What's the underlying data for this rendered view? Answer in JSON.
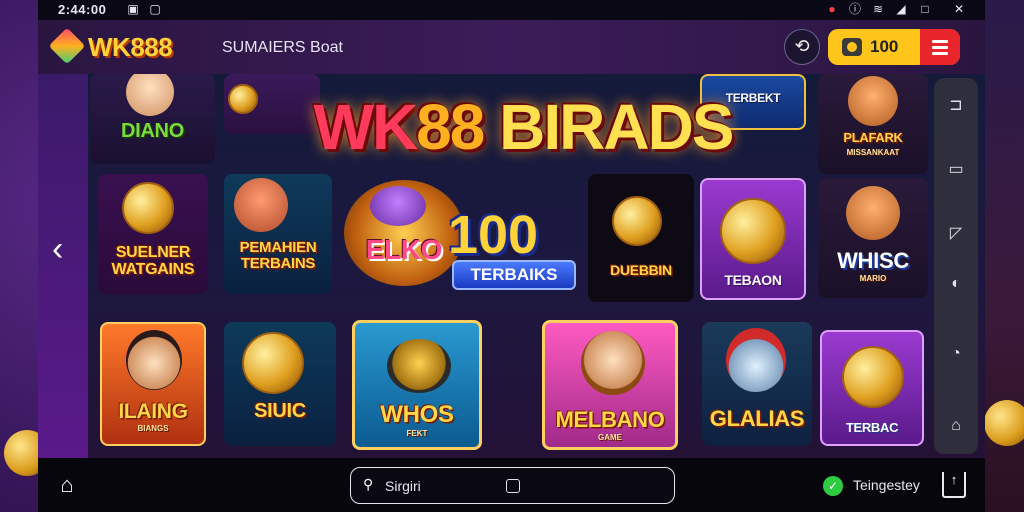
{
  "status_bar": {
    "time": "2:44:00",
    "icons": [
      "app-notification-icon",
      "app-alert-icon",
      "gallery-icon",
      "record-icon",
      "info-icon",
      "wifi-icon",
      "signal-icon",
      "window-icon",
      "close-icon"
    ]
  },
  "app_bar": {
    "logo_text": "WK888",
    "subtitle": "SUMAIERS Boat",
    "balance": "100",
    "colors": {
      "brand_yellow": "#ffc51a",
      "menu_red": "#e8262c"
    }
  },
  "hero": {
    "title_part1": "WK",
    "title_part2": "88",
    "title_part3": " BIRADS",
    "promo_value": "100",
    "promo_label": "TERBAIKS"
  },
  "tiles": [
    {
      "label": "DIANO"
    },
    {
      "label": "TERBEKT"
    },
    {
      "label": "PLAFARK",
      "sub": "MISSANKAAT"
    },
    {
      "label": "SUELNER WATGAINS"
    },
    {
      "label": "PEMAHIEN TERBAINS"
    },
    {
      "label": "ELKO"
    },
    {
      "label": "DUEBBIN"
    },
    {
      "label": "TEBAON"
    },
    {
      "label": "WHISC",
      "sub": "MARIO"
    },
    {
      "label": "ILAING",
      "sub": "BIANGS"
    },
    {
      "label": "SIUIC"
    },
    {
      "label": "WHOS",
      "sub": "FEKT"
    },
    {
      "label": "MELBANO",
      "sub": "GAME"
    },
    {
      "label": "GLALIAS"
    },
    {
      "label": "TERBAC"
    }
  ],
  "right_rail_icons": [
    "bookmark-icon",
    "copy-icon",
    "folder-icon",
    "slider-icon",
    "chat-icon",
    "cloud-icon"
  ],
  "bottom_bar": {
    "search_text": "Sirgiri",
    "online_text": "Teingestey"
  }
}
